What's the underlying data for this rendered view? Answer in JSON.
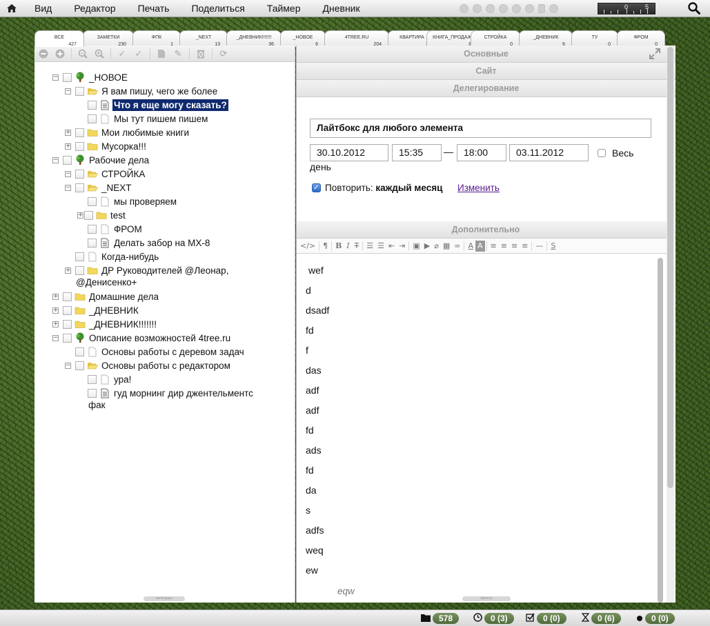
{
  "menu": {
    "items": [
      "Вид",
      "Редактор",
      "Печать",
      "Поделиться",
      "Таймер",
      "Дневник"
    ],
    "ruler": {
      "zero": "0",
      "five": "5"
    }
  },
  "tabs": [
    {
      "label": "ВСЕ",
      "count": "427"
    },
    {
      "label": "ЗАМЕТКИ",
      "count": "230"
    },
    {
      "label": "ФПК",
      "count": "1"
    },
    {
      "label": "_NEXT",
      "count": "13"
    },
    {
      "label": "_ДНЕВНИК!!!!!!!",
      "count": "36"
    },
    {
      "label": "_НОВОЕ",
      "count": "6"
    },
    {
      "label": "4TREE.RU",
      "count": "204"
    },
    {
      "label": "КВАРТИРА",
      "count": "2"
    },
    {
      "label": "КНИГА_ПРОДАЖИ",
      "count": "88"
    },
    {
      "label": "СТРОЙКА",
      "count": "0"
    },
    {
      "label": "_ДНЕВНИК",
      "count": "6"
    },
    {
      "label": "ТУ",
      "count": "0"
    },
    {
      "label": "ФРОМ",
      "count": "0"
    }
  ],
  "tree": {
    "nodes": [
      {
        "label": "_НОВОЕ"
      },
      {
        "label": "Я вам пишу, чего же более"
      },
      {
        "label": "Что я еще могу сказать?"
      },
      {
        "label": "Мы тут пишем пишем"
      },
      {
        "label": "Мои любимые книги"
      },
      {
        "label": "Мусорка!!!"
      },
      {
        "label": "Рабочие дела"
      },
      {
        "label": "СТРОЙКА"
      },
      {
        "label": "_NEXT"
      },
      {
        "label": "мы проверяем"
      },
      {
        "label": "test"
      },
      {
        "label": "ФРОМ"
      },
      {
        "label": "Делать забор на MX-8"
      },
      {
        "label": "Когда-нибудь"
      },
      {
        "label": "ДР Руководителей @Леонар,"
      },
      {
        "label": "Домашние дела"
      },
      {
        "label": "_ДНЕВНИК"
      },
      {
        "label": "_ДНЕВНИК!!!!!!!"
      },
      {
        "label": "Описание возможностей 4tree.ru"
      },
      {
        "label": "Основы работы с деревом задач"
      },
      {
        "label": "Основы работы с редактором"
      },
      {
        "label": "ура!"
      },
      {
        "label": "гуд морнинг дир джентельментс"
      }
    ],
    "wrap1": "@Денисенко+",
    "wrap2": "фак",
    "footer": "календарь"
  },
  "panel": {
    "sections": {
      "main": "Основные",
      "site": "Сайт",
      "delegation": "Делегирование",
      "extra": "Дополнительно"
    },
    "title": "Лайтбокс для любого элемента",
    "date_start": "30.10.2012",
    "time_start": "15:35",
    "dash": "—",
    "time_end": "18:00",
    "date_end": "03.11.2012",
    "allday_1": "Весь",
    "allday_2": "день",
    "repeat_label": "Повторить:",
    "repeat_value": "каждый месяц",
    "repeat_change": "Изменить",
    "footer": "фильтр"
  },
  "note": {
    "lines": [
      "wef",
      "d",
      "dsadf",
      "fd",
      "f",
      "das",
      "adf",
      "adf",
      "fd",
      "ads",
      "fd",
      "da",
      "s",
      "adfs",
      "weq",
      "ew"
    ],
    "signature": "eqw"
  },
  "status": {
    "folders": "578",
    "timers": "0 (3)",
    "checks": "0 (0)",
    "hourglass": "0 (6)",
    "dots": "0 (0)"
  }
}
